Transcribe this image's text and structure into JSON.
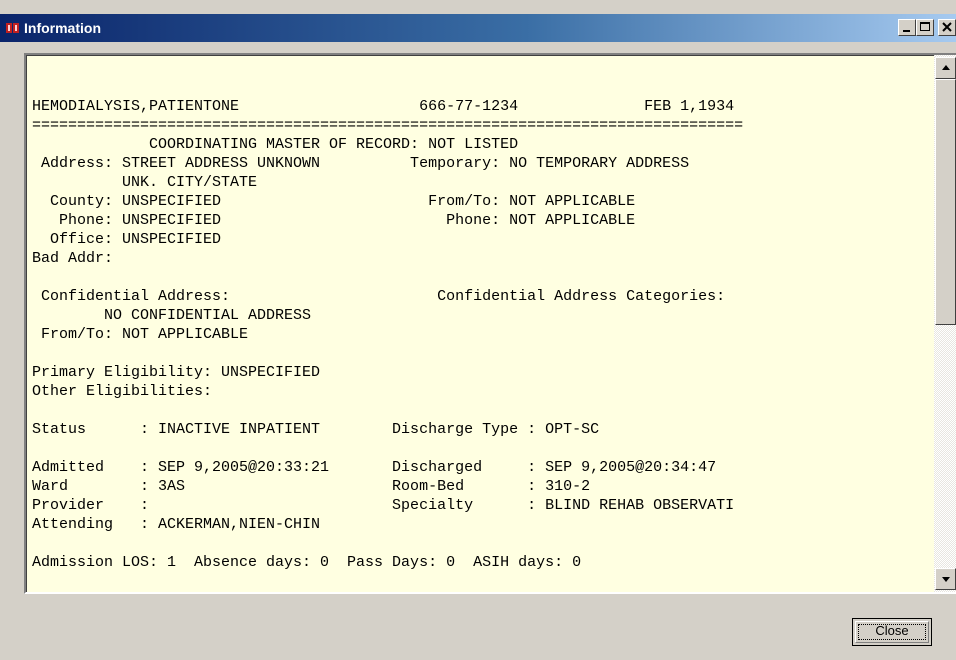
{
  "window": {
    "title": "Information",
    "icon": "app-icon"
  },
  "report": {
    "lines": [
      "",
      "",
      "HEMODIALYSIS,PATIENTONE                    666-77-1234              FEB 1,1934",
      "===============================================================================",
      "             COORDINATING MASTER OF RECORD: NOT LISTED",
      " Address: STREET ADDRESS UNKNOWN          Temporary: NO TEMPORARY ADDRESS",
      "          UNK. CITY/STATE",
      "  County: UNSPECIFIED                       From/To: NOT APPLICABLE",
      "   Phone: UNSPECIFIED                         Phone: NOT APPLICABLE",
      "  Office: UNSPECIFIED",
      "Bad Addr:",
      "",
      " Confidential Address:                       Confidential Address Categories:",
      "        NO CONFIDENTIAL ADDRESS",
      " From/To: NOT APPLICABLE",
      "",
      "Primary Eligibility: UNSPECIFIED",
      "Other Eligibilities:",
      "",
      "Status      : INACTIVE INPATIENT        Discharge Type : OPT-SC",
      "",
      "Admitted    : SEP 9,2005@20:33:21       Discharged     : SEP 9,2005@20:34:47",
      "Ward        : 3AS                       Room-Bed       : 310-2",
      "Provider    :                           Specialty      : BLIND REHAB OBSERVATI",
      "Attending   : ACKERMAN,NIEN-CHIN",
      "",
      "Admission LOS: 1  Absence days: 0  Pass Days: 0  ASIH days: 0"
    ]
  },
  "buttons": {
    "close_label": "Close"
  },
  "colors": {
    "titlebar_start": "#0a246a",
    "titlebar_end": "#a6caf0",
    "text_background": "#ffffe1",
    "window_face": "#d4d0c8"
  }
}
